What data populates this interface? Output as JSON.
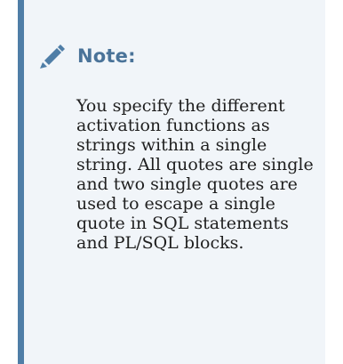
{
  "note": {
    "title": "Note:",
    "body": "You specify the different activation functions as strings within a single string. All quotes are single and two single quotes are used to escape a single quote in SQL statements and PL/SQL blocks.",
    "icon": "pencil-icon",
    "accent_color": "#4f7ea7",
    "title_color": "#4a7399",
    "background_color": "#f1f5f9"
  }
}
